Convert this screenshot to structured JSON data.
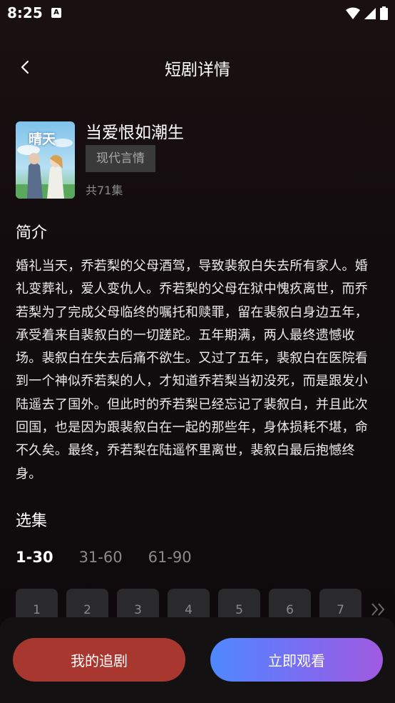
{
  "status_bar": {
    "time": "8:25",
    "app_icon": "A",
    "icons": [
      "wifi-icon",
      "signal-icon",
      "battery-icon"
    ]
  },
  "header": {
    "title": "短剧详情",
    "back_icon": "chevron-left-icon"
  },
  "drama": {
    "title": "当爱恨如潮生",
    "genre": "现代言情",
    "episode_count": "共71集",
    "cover_text": "晴天"
  },
  "intro": {
    "heading": "简介",
    "text": "婚礼当天，乔若梨的父母酒驾，导致裴叙白失去所有家人。婚礼变葬礼，爱人变仇人。乔若梨的父母在狱中愧疚离世，而乔若梨为了完成父母临终的嘱托和赎罪，留在裴叙白身边五年，承受着来自裴叙白的一切蹉跎。五年期满，两人最终遗憾收场。裴叙白在失去后痛不欲生。又过了五年，裴叙白在医院看到一个神似乔若梨的人，才知道乔若梨当初没死，而是跟发小陆遥去了国外。但此时的乔若梨已经忘记了裴叙白，并且此次回国，也是因为跟裴叙白在一起的那些年，身体损耗不堪，命不久矣。最终，乔若梨在陆遥怀里离世，裴叙白最后抱憾终身。"
  },
  "episodes": {
    "heading": "选集",
    "ranges": [
      "1-30",
      "31-60",
      "61-90"
    ],
    "active_range": "1-30",
    "items": [
      "1",
      "2",
      "3",
      "4",
      "5",
      "6",
      "7"
    ],
    "more_icon": "double-chevron-right-icon"
  },
  "actions": {
    "follow_label": "我的追剧",
    "watch_label": "立即观看"
  },
  "colors": {
    "follow_button": "#a8382f",
    "watch_gradient_start": "#4f88ff",
    "watch_gradient_end": "#a05ae0",
    "tag_background": "#3a3a3a"
  }
}
